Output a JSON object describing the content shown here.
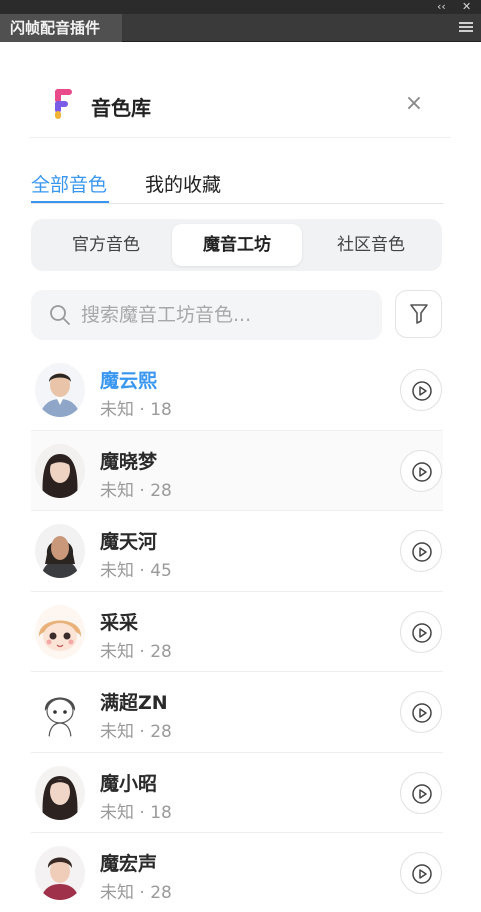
{
  "host": {
    "tab_title": "闪帧配音插件",
    "collapse_glyph": "‹‹",
    "close_glyph": "✕"
  },
  "header": {
    "title": "音色库",
    "close_glyph": "×"
  },
  "top_tabs": [
    "全部音色",
    "我的收藏"
  ],
  "segments": [
    "官方音色",
    "魔音工坊",
    "社区音色"
  ],
  "search": {
    "placeholder": "搜索魔音工坊音色...",
    "value": ""
  },
  "voices": [
    {
      "name": "魔云熙",
      "meta": "未知 · 18",
      "selected": true
    },
    {
      "name": "魔晓梦",
      "meta": "未知 · 28"
    },
    {
      "name": "魔天河",
      "meta": "未知 · 45"
    },
    {
      "name": "采采",
      "meta": "未知 · 28"
    },
    {
      "name": "满超ZN",
      "meta": "未知 · 28"
    },
    {
      "name": "魔小昭",
      "meta": "未知 · 18"
    },
    {
      "name": "魔宏声",
      "meta": "未知 · 28"
    }
  ],
  "colors": {
    "accent": "#3a97f0",
    "text": "#222222",
    "muted": "#9a9a9a"
  }
}
